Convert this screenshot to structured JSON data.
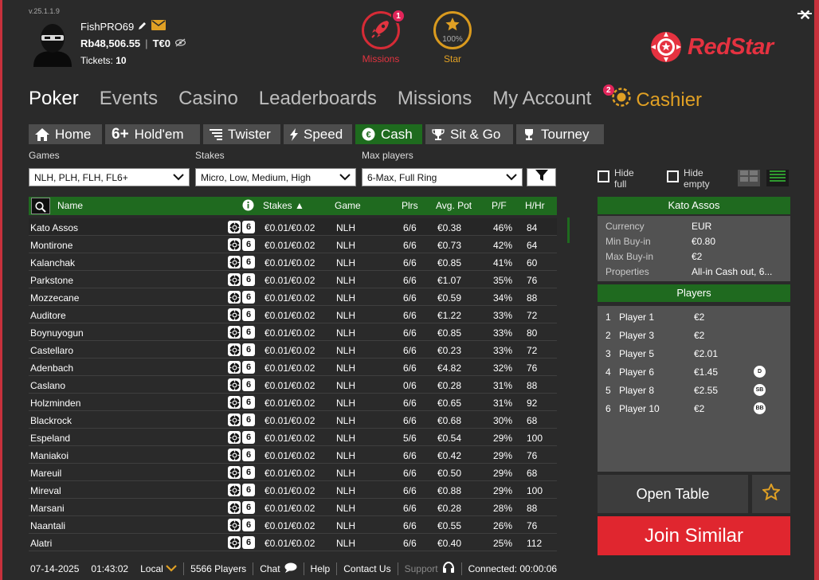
{
  "app": {
    "version": "v.25.1.1.9",
    "brand": "RedStar"
  },
  "user": {
    "username": "FishPRO69",
    "balance": "Rb48,506.55",
    "tournament_money": "T€0",
    "tickets_label": "Tickets:",
    "tickets_count": "10"
  },
  "hubs": {
    "missions_label": "Missions",
    "missions_badge": "1",
    "star_label": "Star",
    "star_percent": "100%"
  },
  "main_nav": {
    "poker": "Poker",
    "events": "Events",
    "casino": "Casino",
    "leaderboards": "Leaderboards",
    "leaderboards_badge": "2",
    "missions": "Missions",
    "my_account": "My Account",
    "cashier": "Cashier"
  },
  "sub_nav": {
    "home": "Home",
    "holdem": "Hold'em",
    "twister": "Twister",
    "speed": "Speed",
    "cash": "Cash",
    "sitgo": "Sit & Go",
    "tourney": "Tourney"
  },
  "filters": {
    "games_label": "Games",
    "games_value": "NLH, PLH, FLH, FL6+",
    "stakes_label": "Stakes",
    "stakes_value": "Micro, Low, Medium, High",
    "maxplayers_label": "Max players",
    "maxplayers_value": "6-Max, Full Ring",
    "hide_full": "Hide full",
    "hide_empty": "Hide empty"
  },
  "table": {
    "columns": {
      "name": "Name",
      "stakes": "Stakes ▲",
      "game": "Game",
      "plrs": "Plrs",
      "avg_pot": "Avg. Pot",
      "pf": "P/F",
      "hhr": "H/Hr"
    },
    "seat_badge": "6",
    "rows": [
      {
        "name": "Kato Assos",
        "stakes": "€0.01/€0.02",
        "game": "NLH",
        "plrs": "6/6",
        "pot": "€0.38",
        "pf": "46%",
        "hhr": "84"
      },
      {
        "name": "Montirone",
        "stakes": "€0.01/€0.02",
        "game": "NLH",
        "plrs": "6/6",
        "pot": "€0.73",
        "pf": "42%",
        "hhr": "64"
      },
      {
        "name": "Kalanchak",
        "stakes": "€0.01/€0.02",
        "game": "NLH",
        "plrs": "6/6",
        "pot": "€0.85",
        "pf": "41%",
        "hhr": "60"
      },
      {
        "name": "Parkstone",
        "stakes": "€0.01/€0.02",
        "game": "NLH",
        "plrs": "6/6",
        "pot": "€1.07",
        "pf": "35%",
        "hhr": "76"
      },
      {
        "name": "Mozzecane",
        "stakes": "€0.01/€0.02",
        "game": "NLH",
        "plrs": "6/6",
        "pot": "€0.59",
        "pf": "34%",
        "hhr": "88"
      },
      {
        "name": "Auditore",
        "stakes": "€0.01/€0.02",
        "game": "NLH",
        "plrs": "6/6",
        "pot": "€1.22",
        "pf": "33%",
        "hhr": "72"
      },
      {
        "name": "Boynuyogun",
        "stakes": "€0.01/€0.02",
        "game": "NLH",
        "plrs": "6/6",
        "pot": "€0.85",
        "pf": "33%",
        "hhr": "80"
      },
      {
        "name": "Castellaro",
        "stakes": "€0.01/€0.02",
        "game": "NLH",
        "plrs": "6/6",
        "pot": "€0.23",
        "pf": "33%",
        "hhr": "72"
      },
      {
        "name": "Adenbach",
        "stakes": "€0.01/€0.02",
        "game": "NLH",
        "plrs": "6/6",
        "pot": "€4.82",
        "pf": "32%",
        "hhr": "76"
      },
      {
        "name": "Caslano",
        "stakes": "€0.01/€0.02",
        "game": "NLH",
        "plrs": "0/6",
        "pot": "€0.28",
        "pf": "31%",
        "hhr": "88"
      },
      {
        "name": "Holzminden",
        "stakes": "€0.01/€0.02",
        "game": "NLH",
        "plrs": "6/6",
        "pot": "€0.65",
        "pf": "31%",
        "hhr": "92"
      },
      {
        "name": "Blackrock",
        "stakes": "€0.01/€0.02",
        "game": "NLH",
        "plrs": "6/6",
        "pot": "€0.68",
        "pf": "30%",
        "hhr": "68"
      },
      {
        "name": "Espeland",
        "stakes": "€0.01/€0.02",
        "game": "NLH",
        "plrs": "5/6",
        "pot": "€0.54",
        "pf": "29%",
        "hhr": "100"
      },
      {
        "name": "Maniakoi",
        "stakes": "€0.01/€0.02",
        "game": "NLH",
        "plrs": "6/6",
        "pot": "€0.42",
        "pf": "29%",
        "hhr": "76"
      },
      {
        "name": "Mareuil",
        "stakes": "€0.01/€0.02",
        "game": "NLH",
        "plrs": "6/6",
        "pot": "€0.50",
        "pf": "29%",
        "hhr": "68"
      },
      {
        "name": "Mireval",
        "stakes": "€0.01/€0.02",
        "game": "NLH",
        "plrs": "6/6",
        "pot": "€0.88",
        "pf": "29%",
        "hhr": "100"
      },
      {
        "name": "Marsani",
        "stakes": "€0.01/€0.02",
        "game": "NLH",
        "plrs": "6/6",
        "pot": "€0.28",
        "pf": "28%",
        "hhr": "88"
      },
      {
        "name": "Naantali",
        "stakes": "€0.01/€0.02",
        "game": "NLH",
        "plrs": "6/6",
        "pot": "€0.55",
        "pf": "26%",
        "hhr": "76"
      },
      {
        "name": "Alatri",
        "stakes": "€0.01/€0.02",
        "game": "NLH",
        "plrs": "6/6",
        "pot": "€0.40",
        "pf": "25%",
        "hhr": "112"
      }
    ]
  },
  "table_info": {
    "title": "Kato Assos",
    "currency_label": "Currency",
    "currency_value": "EUR",
    "min_buyin_label": "Min Buy-in",
    "min_buyin_value": "€0.80",
    "max_buyin_label": "Max Buy-in",
    "max_buyin_value": "€2",
    "properties_label": "Properties",
    "properties_value": "All-in Cash out, 6..."
  },
  "players": {
    "title": "Players",
    "list": [
      {
        "seat": "1",
        "name": "Player 1",
        "stack": "€2",
        "pos": ""
      },
      {
        "seat": "2",
        "name": "Player 3",
        "stack": "€2",
        "pos": ""
      },
      {
        "seat": "3",
        "name": "Player 5",
        "stack": "€2.01",
        "pos": ""
      },
      {
        "seat": "4",
        "name": "Player 6",
        "stack": "€1.45",
        "pos": "D"
      },
      {
        "seat": "5",
        "name": "Player 8",
        "stack": "€2.55",
        "pos": "SB"
      },
      {
        "seat": "6",
        "name": "Player 10",
        "stack": "€2",
        "pos": "BB"
      }
    ]
  },
  "actions": {
    "open_table": "Open Table",
    "join_similar": "Join Similar"
  },
  "status": {
    "date": "07-14-2025",
    "time": "01:43:02",
    "timezone": "Local",
    "players": "5566 Players",
    "chat": "Chat",
    "help": "Help",
    "contact": "Contact Us",
    "support": "Support",
    "connected": "Connected: 00:00:06"
  },
  "colors": {
    "accent_green": "#1f6a1f",
    "brand_red": "#e0262f",
    "gold": "#e0a024"
  }
}
